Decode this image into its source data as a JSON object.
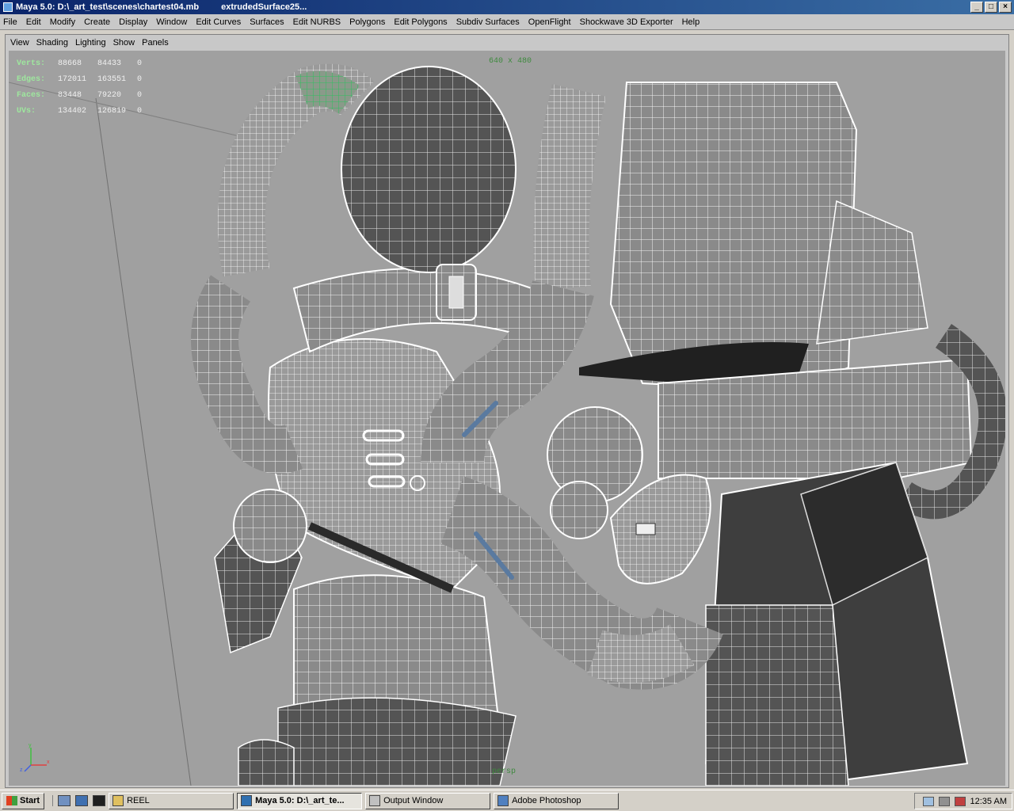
{
  "window": {
    "title": "Maya 5.0: D:\\_art_test\\scenes\\chartest04.mb",
    "object": "extrudedSurface25...",
    "buttons": {
      "minimize": "_",
      "maximize": "□",
      "close": "×"
    }
  },
  "menubar": [
    "File",
    "Edit",
    "Modify",
    "Create",
    "Display",
    "Window",
    "Edit Curves",
    "Surfaces",
    "Edit NURBS",
    "Polygons",
    "Edit Polygons",
    "Subdiv Surfaces",
    "OpenFlight",
    "Shockwave 3D Exporter",
    "Help"
  ],
  "panel_menu": [
    "View",
    "Shading",
    "Lighting",
    "Show",
    "Panels"
  ],
  "hud": [
    {
      "label": "Verts:",
      "v1": "88668",
      "v2": "84433",
      "v3": "0"
    },
    {
      "label": "Edges:",
      "v1": "172011",
      "v2": "163551",
      "v3": "0"
    },
    {
      "label": "Faces:",
      "v1": "83448",
      "v2": "79220",
      "v3": "0"
    },
    {
      "label": "UVs:",
      "v1": "134402",
      "v2": "126819",
      "v3": "0"
    }
  ],
  "resolution_gate": "640 x 480",
  "camera": "persp",
  "taskbar": {
    "start": "Start",
    "tasks": [
      {
        "label": "REEL",
        "active": false
      },
      {
        "label": "Maya 5.0: D:\\_art_te...",
        "active": true
      },
      {
        "label": "Output Window",
        "active": false
      },
      {
        "label": "Adobe Photoshop",
        "active": false
      }
    ],
    "clock": "12:35 AM"
  },
  "colors": {
    "title_bar": "#0a246a",
    "viewport_bg": "#a0a0a0",
    "wire": "#ffffff",
    "selected_wire": "#30c060"
  }
}
